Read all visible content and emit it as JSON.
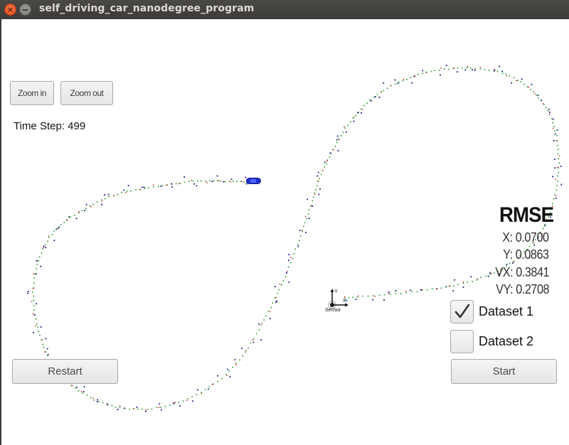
{
  "window": {
    "title": "self_driving_car_nanodegree_program",
    "close_glyph": "×"
  },
  "toolbar": {
    "zoom_in_label": "Zoom in",
    "zoom_out_label": "Zoom out"
  },
  "status": {
    "time_step_label": "Time Step: 499"
  },
  "rmse": {
    "title": "RMSE",
    "x": "X: 0.0700",
    "y": "Y: 0.0863",
    "vx": "VX: 0.3841",
    "vy": "VY: 0.2708"
  },
  "datasets": [
    {
      "label": "Dataset 1",
      "checked": true
    },
    {
      "label": "Dataset 2",
      "checked": false
    }
  ],
  "controls": {
    "restart_label": "Restart",
    "start_label": "Start"
  },
  "sensor": {
    "label": "Sensor",
    "x_axis": "X",
    "y_axis": "Y"
  },
  "legend_colors": {
    "ground_truth": "#1aa01a",
    "lidar": "#d01010",
    "radar": "#1a1a80",
    "car": "#1e2fd0"
  }
}
